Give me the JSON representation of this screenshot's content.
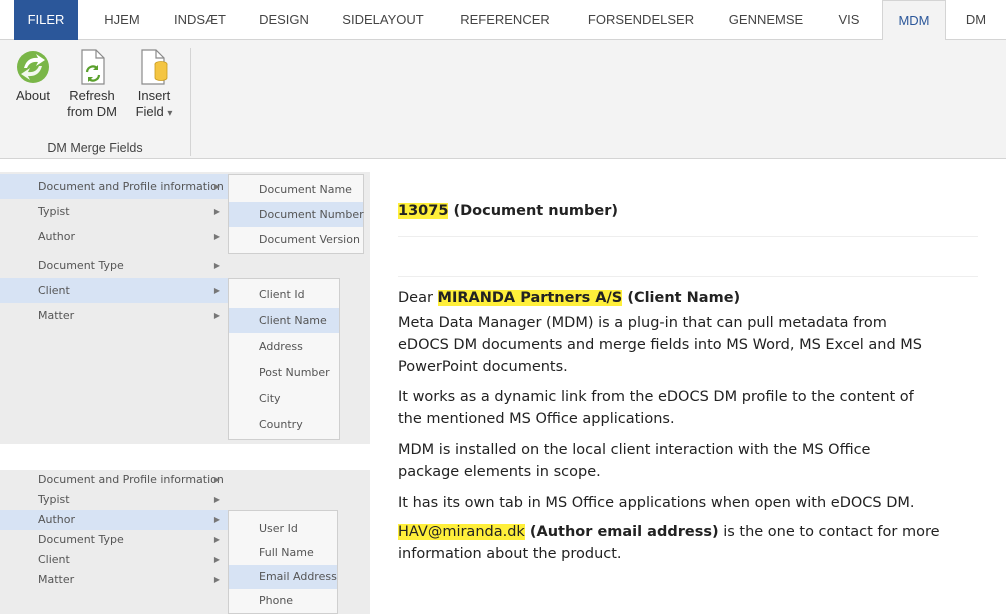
{
  "ribbon_tabs": [
    {
      "label": "FILER"
    },
    {
      "label": "HJEM"
    },
    {
      "label": "INDSÆT"
    },
    {
      "label": "DESIGN"
    },
    {
      "label": "SIDELAYOUT"
    },
    {
      "label": "REFERENCER"
    },
    {
      "label": "FORSENDELSER"
    },
    {
      "label": "GENNEMSE"
    },
    {
      "label": "VIS"
    },
    {
      "label": "MDM"
    },
    {
      "label": "DM"
    }
  ],
  "active_tab": "MDM",
  "ribbon_buttons": {
    "about": {
      "line1": "About",
      "icon": "about-icon"
    },
    "refresh": {
      "line1": "Refresh",
      "line2": "from DM",
      "icon": "refresh-icon"
    },
    "insert": {
      "line1": "Insert",
      "line2": "Field",
      "dropdown": "▾",
      "icon": "insert-field-icon"
    }
  },
  "group_label": "DM Merge Fields",
  "menu_top": {
    "items": [
      {
        "label": "Document and Profile information"
      },
      {
        "label": "Typist"
      },
      {
        "label": "Author"
      },
      {
        "label": "Document Type"
      },
      {
        "label": "Client"
      },
      {
        "label": "Matter"
      }
    ],
    "submenu_document": [
      "Document Name",
      "Document Number",
      "Document Version"
    ],
    "submenu_client": [
      "Client Id",
      "Client Name",
      "Address",
      "Post Number",
      "City",
      "Country"
    ]
  },
  "menu_bottom": {
    "items": [
      {
        "label": "Document and Profile information"
      },
      {
        "label": "Typist"
      },
      {
        "label": "Author"
      },
      {
        "label": "Document Type"
      },
      {
        "label": "Client"
      },
      {
        "label": "Matter"
      }
    ],
    "submenu_author": [
      "User Id",
      "Full Name",
      "Email Address",
      "Phone"
    ]
  },
  "document": {
    "docnum_value": "13075",
    "docnum_label": " (Document number)",
    "dear": "Dear ",
    "client_value": "MIRANDA Partners A/S",
    "client_label": " (Client Name)",
    "para1_l1": "Meta Data Manager (MDM) is a plug-in that can pull metadata from",
    "para1_l2": "eDOCS DM documents and merge fields into MS Word, MS Excel and MS",
    "para1_l3": "PowerPoint documents.",
    "para2_l1": "It works as a dynamic link from the eDOCS DM profile to the content of",
    "para2_l2": "the mentioned MS Office applications.",
    "para3_l1": "MDM is installed on the local client interaction with the MS Office",
    "para3_l2": "package elements in scope.",
    "para4_l1": "It has its own tab in MS Office applications when open with eDOCS DM.",
    "email_value": "HAV@miranda.dk",
    "email_label": " (Author email address)",
    "para5_rest": " is the one to contact for more",
    "para5_l2": "information about the product."
  },
  "colors": {
    "filer_tab": "#2b579a",
    "highlight": "#ffef3a",
    "menu_highlight": "#d7e3f4"
  }
}
